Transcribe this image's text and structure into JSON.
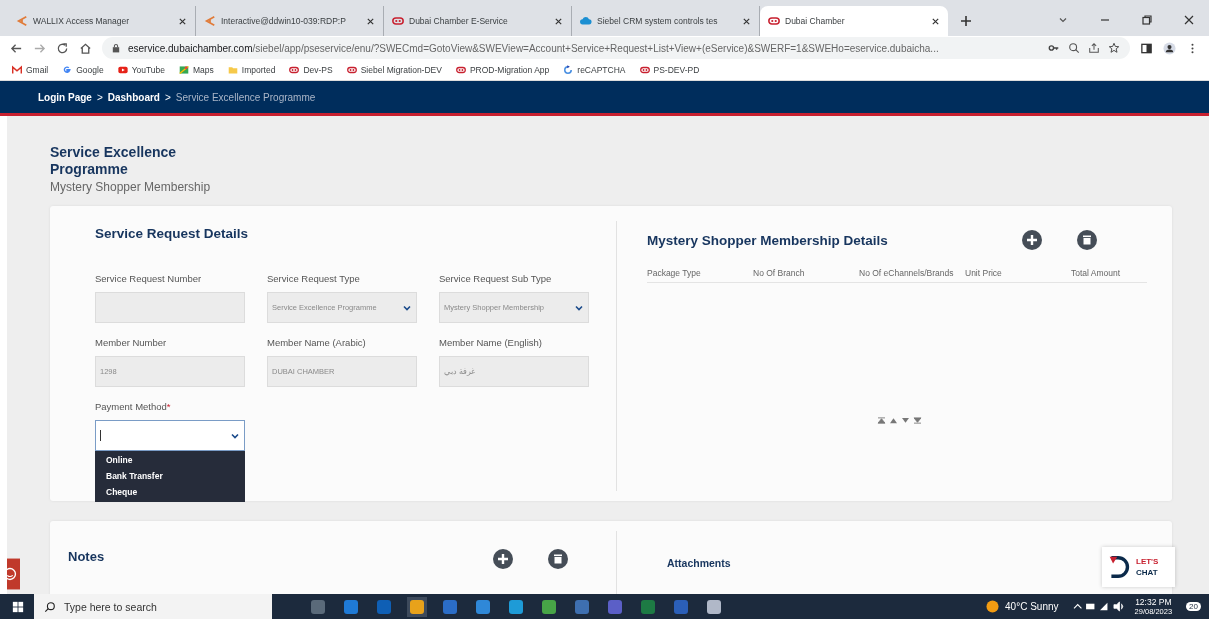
{
  "browser": {
    "tabs": [
      {
        "title": "WALLIX Access Manager",
        "kind": "wallix",
        "selected": false
      },
      {
        "title": "Interactive@ddwin10-039:RDP:P",
        "kind": "wallix",
        "selected": false
      },
      {
        "title": "Dubai Chamber E-Service",
        "kind": "chamber",
        "selected": false
      },
      {
        "title": "Siebel CRM system controls tes",
        "kind": "cloud",
        "selected": false
      },
      {
        "title": "Dubai Chamber",
        "kind": "chamber",
        "selected": true
      }
    ],
    "url_host": "eservice.dubaichamber.com",
    "url_path": "/siebel/app/pseservice/enu/?SWECmd=GotoView&SWEView=Account+Service+Request+List+View+(eService)&SWERF=1&SWEHo=eservice.dubaicha...",
    "bookmarks": [
      {
        "label": "Gmail",
        "kind": "gmail"
      },
      {
        "label": "Google",
        "kind": "google"
      },
      {
        "label": "YouTube",
        "kind": "youtube"
      },
      {
        "label": "Maps",
        "kind": "maps"
      },
      {
        "label": "Imported",
        "kind": "folder"
      },
      {
        "label": "Dev-PS",
        "kind": "chamber"
      },
      {
        "label": "Siebel Migration-DEV",
        "kind": "chamber"
      },
      {
        "label": "PROD-Migration App",
        "kind": "chamber"
      },
      {
        "label": "reCAPTCHA",
        "kind": "recaptcha"
      },
      {
        "label": "PS-DEV-PD",
        "kind": "chamber"
      }
    ]
  },
  "breadcrumb": {
    "separator": ">",
    "items": [
      {
        "label": "Login Page",
        "current": false
      },
      {
        "label": "Dashboard",
        "current": false
      },
      {
        "label": "Service Excellence Programme",
        "current": true
      }
    ]
  },
  "page": {
    "title": "Service Excellence Programme",
    "subtitle": "Mystery Shopper Membership"
  },
  "request_details": {
    "title": "Service Request Details",
    "fields": [
      {
        "label": "Service Request Number",
        "kind": "text",
        "disabled": true
      },
      {
        "label": "Service Request Type",
        "kind": "select",
        "value": "Service Excellence Programme",
        "disabled": true
      },
      {
        "label": "Service Request Sub Type",
        "kind": "select",
        "value": "Mystery Shopper Membership",
        "disabled": true
      },
      {
        "label": "Member Number",
        "kind": "text",
        "value": "1298",
        "disabled": true
      },
      {
        "label": "Member Name (Arabic)",
        "kind": "text",
        "value": "DUBAI CHAMBER",
        "disabled": true
      },
      {
        "label": "Member Name (English)",
        "kind": "text",
        "value": "غرفة دبي",
        "disabled": true
      },
      {
        "label": "Payment Method",
        "required_mark": "*",
        "kind": "select",
        "disabled": false,
        "expanded": true,
        "options": [
          "Online",
          "Bank Transfer",
          "Cheque"
        ]
      }
    ]
  },
  "membership_details": {
    "title": "Mystery Shopper Membership Details",
    "columns": [
      "Package Type",
      "No Of Branch",
      "No Of eChannels/Brands",
      "Unit Price",
      "Total Amount"
    ]
  },
  "notes": {
    "title": "Notes"
  },
  "attachments": {
    "title": "Attachments"
  },
  "chat": {
    "lines": [
      "LET'S",
      "CHAT"
    ]
  },
  "taskbar": {
    "search_placeholder": "Type here to search",
    "weather": "40°C Sunny",
    "time": "12:32 PM",
    "date": "29/08/2023",
    "notifications": "20"
  }
}
